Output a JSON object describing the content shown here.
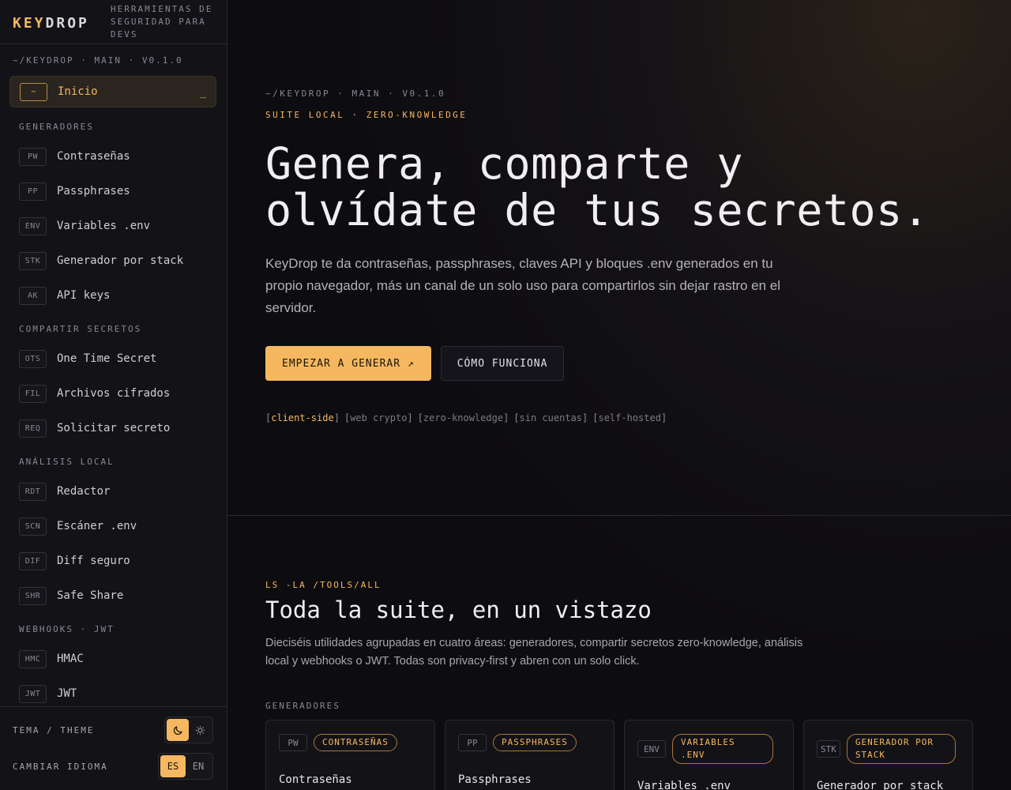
{
  "brand": {
    "logo_key": "KEY",
    "logo_drop": "DROP",
    "tagline": "Herramientas de seguridad para devs"
  },
  "sidebar": {
    "path": "~/keydrop · main · v0.1.0",
    "home": {
      "code": "~",
      "label": "Inicio",
      "cursor": "_"
    },
    "groups": [
      {
        "title": "Generadores",
        "items": [
          {
            "code": "PW",
            "label": "Contraseñas"
          },
          {
            "code": "PP",
            "label": "Passphrases"
          },
          {
            "code": "ENV",
            "label": "Variables .env"
          },
          {
            "code": "STK",
            "label": "Generador por stack"
          },
          {
            "code": "AK",
            "label": "API keys"
          }
        ]
      },
      {
        "title": "Compartir secretos",
        "items": [
          {
            "code": "OTS",
            "label": "One Time Secret"
          },
          {
            "code": "FIL",
            "label": "Archivos cifrados"
          },
          {
            "code": "REQ",
            "label": "Solicitar secreto"
          }
        ]
      },
      {
        "title": "Análisis local",
        "items": [
          {
            "code": "RDT",
            "label": "Redactor"
          },
          {
            "code": "SCN",
            "label": "Escáner .env"
          },
          {
            "code": "DIF",
            "label": "Diff seguro"
          },
          {
            "code": "SHR",
            "label": "Safe Share"
          }
        ]
      },
      {
        "title": "Webhooks · JWT",
        "items": [
          {
            "code": "HMC",
            "label": "HMAC"
          },
          {
            "code": "JWT",
            "label": "JWT"
          }
        ]
      }
    ],
    "footer": {
      "theme_label": "Tema / Theme",
      "theme_dark_icon": "moon-icon",
      "theme_light_icon": "sun-icon",
      "lang_label": "Cambiar idioma",
      "lang_es": "ES",
      "lang_en": "EN"
    }
  },
  "hero": {
    "path": "~/keydrop · main · v0.1.0",
    "eyebrow": "Suite local · zero-knowledge",
    "title_line1": "Genera, comparte y",
    "title_line2": "olvídate de tus secretos.",
    "description": "KeyDrop te da contraseñas, passphrases, claves API y bloques .env generados en tu propio navegador, más un canal de un solo uso para compartirlos sin dejar rastro en el servidor.",
    "primary_cta": "Empezar a generar ↗",
    "secondary_cta": "Cómo funciona",
    "tags": [
      "client-side",
      "web crypto",
      "zero-knowledge",
      "sin cuentas",
      "self-hosted"
    ]
  },
  "suite": {
    "eyebrow": "ls -la /tools/all",
    "title": "Toda la suite, en un vistazo",
    "description": "Dieciséis utilidades agrupadas en cuatro áreas: generadores, compartir secretos zero-knowledge, análisis local y webhooks o JWT. Todas son privacy-first y abren con un solo click.",
    "group_label": "Generadores",
    "cards": [
      {
        "code": "PW",
        "chip": "Contraseñas",
        "title": "Contraseñas"
      },
      {
        "code": "PP",
        "chip": "Passphrases",
        "title": "Passphrases"
      },
      {
        "code": "ENV",
        "chip": "Variables .env",
        "title": "Variables .env"
      },
      {
        "code": "STK",
        "chip": "Generador por stack",
        "title": "Generador por stack"
      }
    ]
  },
  "colors": {
    "accent": "#f5b860",
    "background": "#0d0c10",
    "sidebar": "#131217"
  }
}
